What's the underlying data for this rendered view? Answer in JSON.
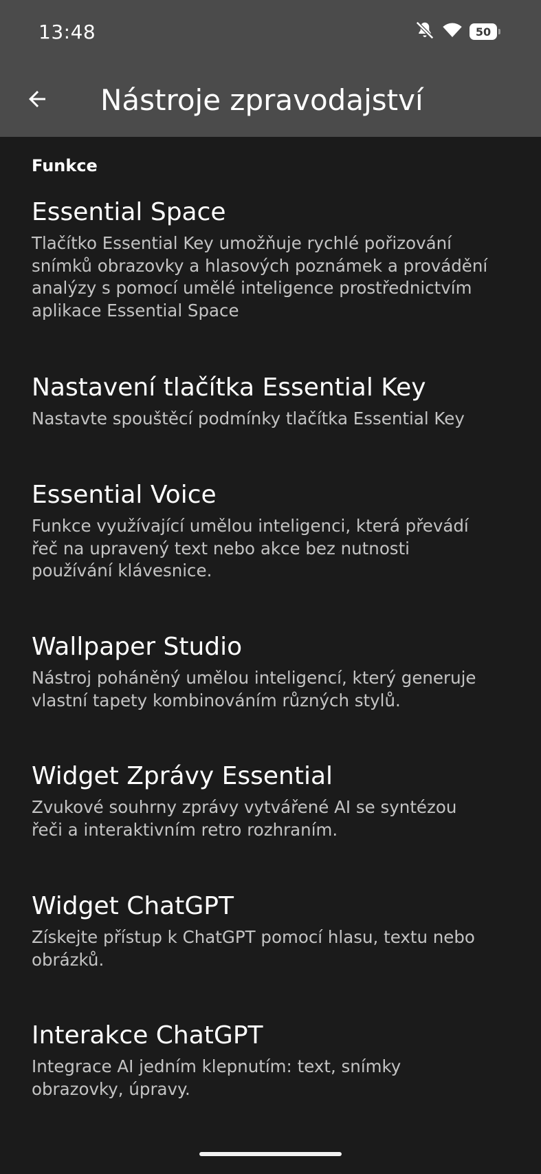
{
  "status_bar": {
    "time": "13:48",
    "battery": "50",
    "icons": [
      "mute-icon",
      "wifi-icon",
      "battery-icon"
    ]
  },
  "app_bar": {
    "title": "Nástroje zpravodajství",
    "back_icon": "arrow-left-icon"
  },
  "section": {
    "header": "Funkce"
  },
  "items": [
    {
      "title": "Essential Space",
      "desc_lines": [
        "Tlačítko Essential Key umožňuje rychlé pořizování",
        "snímků obrazovky a hlasových poznámek a provádění",
        "analýzy s pomocí umělé inteligence prostřednictvím",
        "aplikace Essential Space"
      ]
    },
    {
      "title": "Nastavení tlačítka Essential Key",
      "desc_lines": [
        "Nastavte spouštěcí podmínky tlačítka Essential Key"
      ]
    },
    {
      "title": "Essential Voice",
      "desc_lines": [
        "Funkce využívající umělou inteligenci, která převádí",
        "řeč na upravený text nebo akce bez nutnosti",
        "používání klávesnice."
      ]
    },
    {
      "title": "Wallpaper Studio",
      "desc_lines": [
        "Nástroj poháněný umělou inteligencí, který generuje",
        "vlastní tapety kombinováním různých stylů."
      ]
    },
    {
      "title": "Widget Zprávy Essential",
      "desc_lines": [
        "Zvukové souhrny zprávy vytvářené AI se syntézou",
        "řeči a interaktivním retro rozhraním."
      ]
    },
    {
      "title": "Widget ChatGPT",
      "desc_lines": [
        "Získejte přístup k ChatGPT pomocí hlasu, textu nebo",
        "obrázků."
      ]
    },
    {
      "title": "Interakce ChatGPT",
      "desc_lines": [
        "Integrace AI jedním klepnutím: text, snímky",
        "obrazovky, úpravy."
      ]
    }
  ]
}
